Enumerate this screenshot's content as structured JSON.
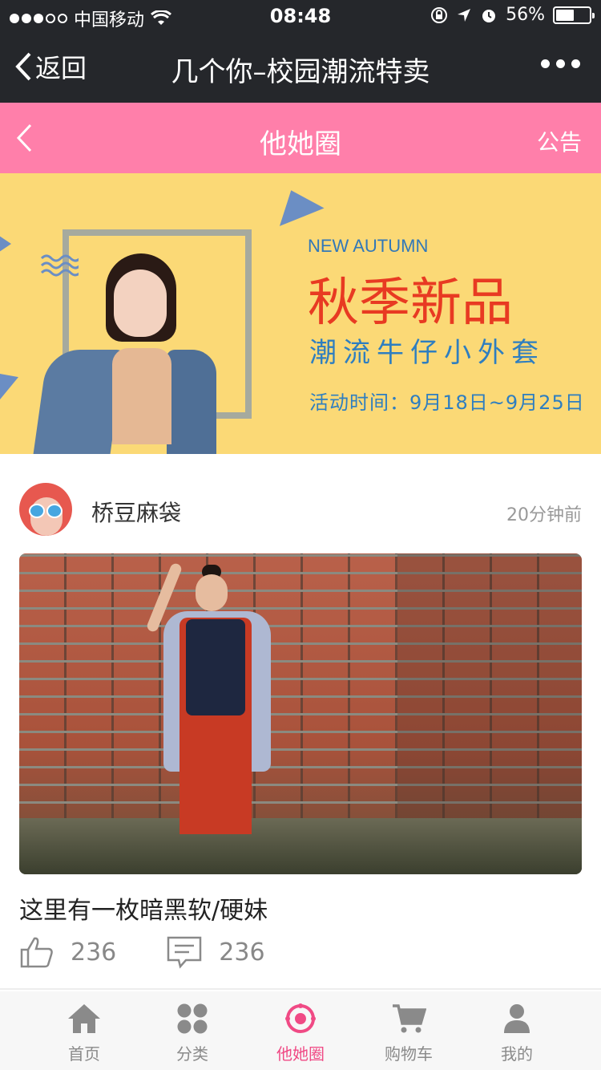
{
  "status_bar": {
    "carrier": "中国移动",
    "time": "08:48",
    "battery": "56%",
    "battery_level": 0.56
  },
  "wechat_nav": {
    "back_label": "返回",
    "title": "几个你–校园潮流特卖"
  },
  "header": {
    "title": "他她圈",
    "notice_label": "公告"
  },
  "banner": {
    "en_title": "NEW AUTUMN",
    "cn_title": "秋季新品",
    "subtitle": "潮流牛仔小外套",
    "date": "活动时间：9月18日~9月25日"
  },
  "post": {
    "username": "桥豆麻袋",
    "time": "20分钟前",
    "title": "这里有一枚暗黑软/硬妹",
    "likes": "236",
    "comments": "236"
  },
  "tabs": [
    {
      "label": "首页",
      "icon": "home-icon",
      "active": false
    },
    {
      "label": "分类",
      "icon": "category-icon",
      "active": false
    },
    {
      "label": "他她圈",
      "icon": "circle-icon",
      "active": true
    },
    {
      "label": "购物车",
      "icon": "cart-icon",
      "active": false
    },
    {
      "label": "我的",
      "icon": "user-icon",
      "active": false
    }
  ],
  "colors": {
    "accent": "#ff7faa",
    "active_tab": "#f04a85",
    "banner_bg": "#fbd976"
  }
}
